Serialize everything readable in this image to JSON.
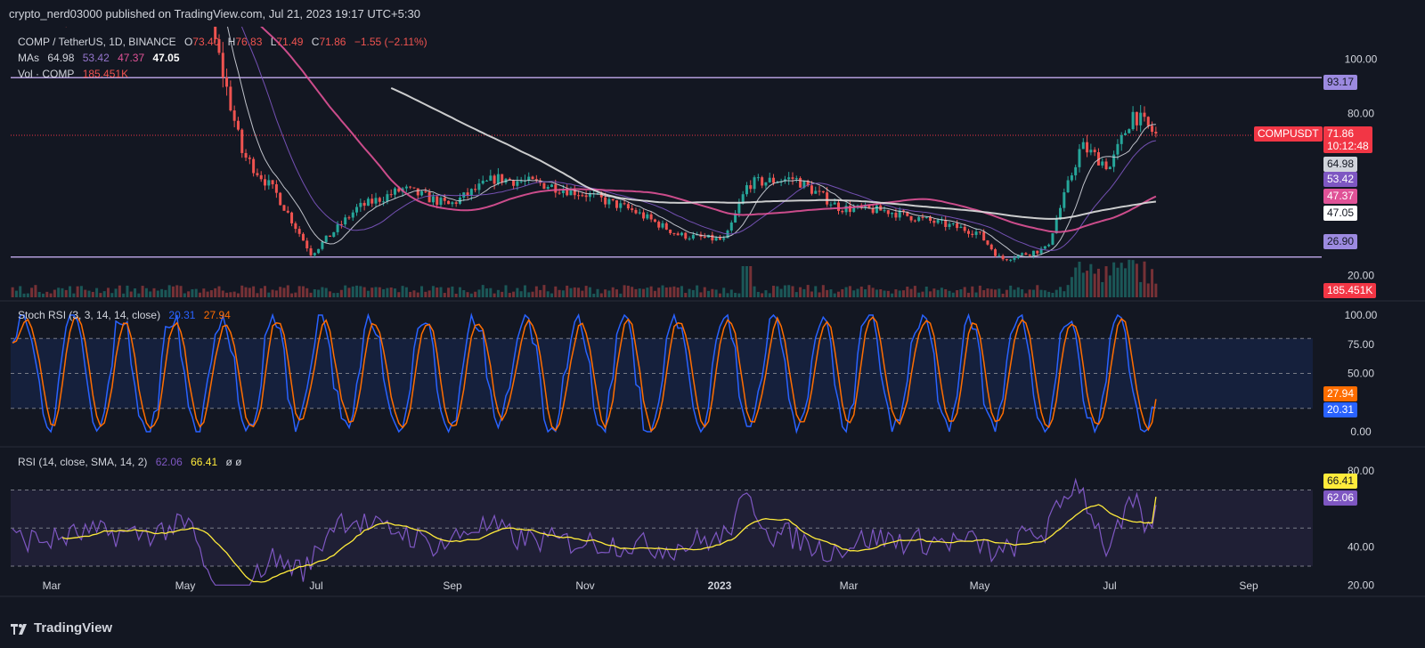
{
  "publisher_line": "crypto_nerd03000 published on TradingView.com, Jul 21, 2023 19:17 UTC+5:30",
  "brand": "TradingView",
  "colors": {
    "bg": "#131722",
    "up": "#26a69a",
    "down": "#ef5350",
    "ma1": "#d1d4dc",
    "ma2": "#7e57c2",
    "ma3": "#e05297",
    "ma4": "#e0e0e0",
    "level_line": "#b39ddb",
    "stoch_k": "#2962ff",
    "stoch_d": "#ff6d00",
    "rsi": "#7e57c2",
    "rsi_ma": "#ffeb3b"
  },
  "main": {
    "symbol_line": "COMP / TetherUS, 1D, BINANCE",
    "ohlc": {
      "o_label": "O",
      "o": "73.40",
      "h_label": "H",
      "h": "76.83",
      "l_label": "L",
      "l": "71.49",
      "c_label": "C",
      "c": "71.86",
      "change": "−1.55 (−2.11%)"
    },
    "mas_label": "MAs",
    "mas_values": [
      "64.98",
      "53.42",
      "47.37",
      "47.05"
    ],
    "vol_label": "Vol · COMP",
    "vol_value": "185.451K",
    "y_ticks": [
      "100.00",
      "80.00",
      "20.00"
    ],
    "levels": [
      "93.17",
      "26.90"
    ],
    "last_price_label": "COMPUSDT",
    "last_price": "71.86",
    "countdown": "10:12:48",
    "ma_tags": [
      "64.98",
      "53.42",
      "47.37",
      "47.05"
    ],
    "vol_tag": "185.451K"
  },
  "stoch": {
    "label": "Stoch RSI (3, 3, 14, 14, close)",
    "k": "20.31",
    "d": "27.94",
    "y_ticks": [
      "100.00",
      "75.00",
      "50.00",
      "0.00"
    ],
    "k_tag": "20.31",
    "d_tag": "27.94"
  },
  "rsi": {
    "label": "RSI (14, close, SMA, 14, 2)",
    "rsi_value": "62.06",
    "ma_value": "66.41",
    "extra": "ø ø",
    "y_ticks": [
      "80.00",
      "40.00",
      "20.00"
    ],
    "rsi_tag": "62.06",
    "ma_tag": "66.41"
  },
  "x_axis": [
    "Mar",
    "May",
    "Jul",
    "Sep",
    "Nov",
    "2023",
    "Mar",
    "May",
    "Jul",
    "Sep"
  ],
  "chart_data": {
    "type": "candlestick",
    "symbol": "COMP / TetherUS",
    "timeframe": "1D",
    "ylim": [
      12,
      112
    ],
    "levels": [
      93.17,
      26.9
    ],
    "last_close": 71.86,
    "ma_last": [
      64.98,
      53.42,
      47.37,
      47.05
    ],
    "price_path": {
      "t": [
        0,
        0.04,
        0.08,
        0.12,
        0.16,
        0.2,
        0.23,
        0.26,
        0.3,
        0.34,
        0.38,
        0.42,
        0.46,
        0.5,
        0.54,
        0.58,
        0.62,
        0.64,
        0.68,
        0.72,
        0.76,
        0.8,
        0.84,
        0.86,
        0.9,
        0.93,
        0.955,
        0.975,
        0.995
      ],
      "price": [
        120,
        118,
        122,
        125,
        135,
        65,
        50,
        28,
        45,
        52,
        46,
        56,
        54,
        50,
        44,
        35,
        33,
        54,
        56,
        45,
        44,
        40,
        36,
        26,
        30,
        68,
        60,
        80,
        72
      ]
    },
    "stoch_k_last": 20.31,
    "stoch_d_last": 27.94,
    "stoch_levels": [
      80,
      20
    ],
    "rsi_last": 62.06,
    "rsi_ma_last": 66.41,
    "rsi_levels": [
      70,
      50,
      30
    ]
  }
}
